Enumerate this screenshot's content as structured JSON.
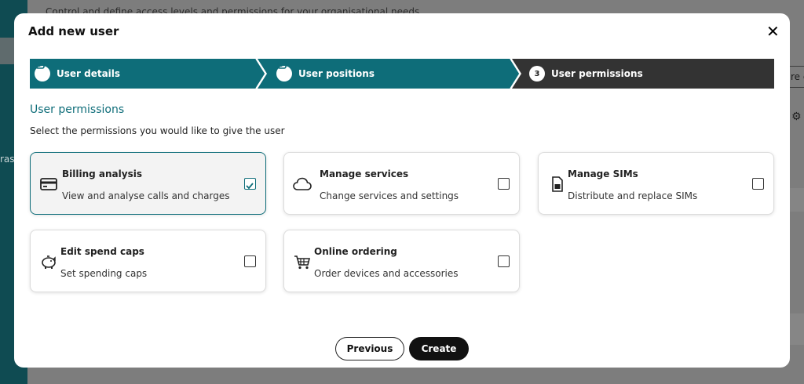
{
  "background": {
    "subtitle": "Control and define access levels and permissions for your organisational needs",
    "edge_text": "ras",
    "right_button": "re c"
  },
  "modal": {
    "title": "Add new user",
    "close_icon": "close-icon"
  },
  "stepper": {
    "steps": [
      {
        "label": "User details",
        "state": "completed"
      },
      {
        "label": "User positions",
        "state": "completed"
      },
      {
        "label": "User permissions",
        "state": "active",
        "number": "3"
      }
    ],
    "colors": {
      "completed": "#0e6d79",
      "active": "#333333"
    }
  },
  "section": {
    "title": "User permissions",
    "description": "Select the permissions you would like to give the user"
  },
  "permissions": [
    {
      "title": "Billing analysis",
      "description": "View and analyse calls and charges",
      "icon": "credit-card-icon",
      "checked": true
    },
    {
      "title": "Manage services",
      "description": "Change services and settings",
      "icon": "cloud-icon",
      "checked": false
    },
    {
      "title": "Manage SIMs",
      "description": "Distribute and replace SIMs",
      "icon": "sim-card-icon",
      "checked": false
    },
    {
      "title": "Edit spend caps",
      "description": "Set spending caps",
      "icon": "piggy-bank-icon",
      "checked": false
    },
    {
      "title": "Online ordering",
      "description": "Order devices and accessories",
      "icon": "shopping-cart-icon",
      "checked": false
    }
  ],
  "buttons": {
    "previous": "Previous",
    "create": "Create"
  }
}
